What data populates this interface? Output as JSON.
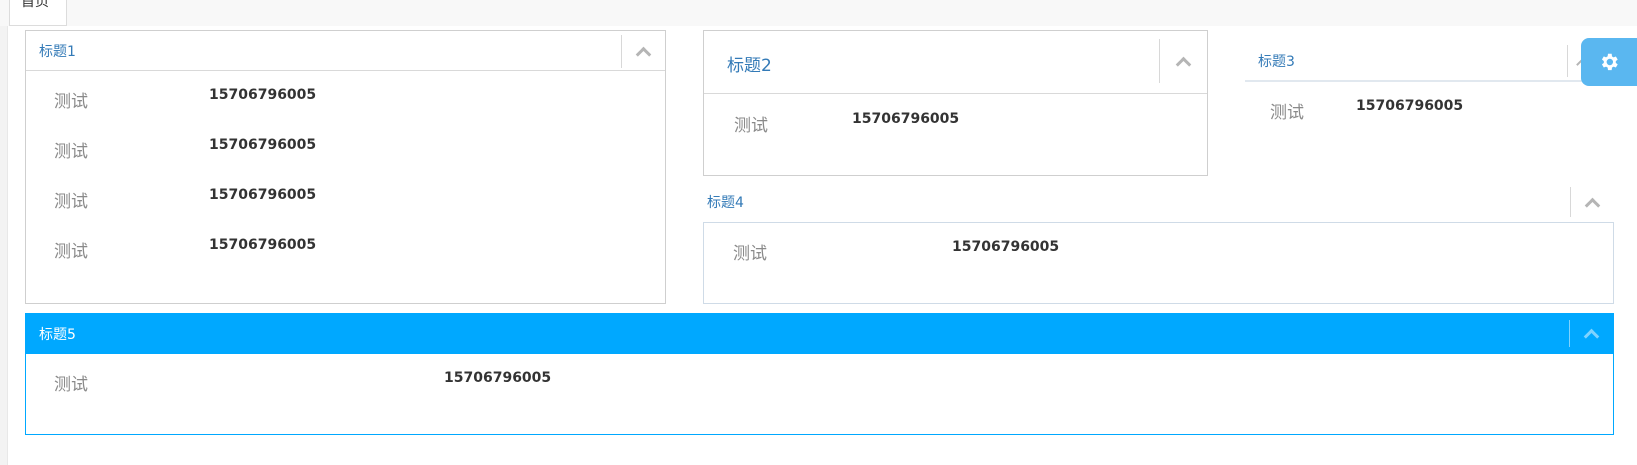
{
  "tabs": [
    {
      "label": "首页"
    }
  ],
  "panels": {
    "p1": {
      "title": "标题1",
      "rows": [
        {
          "label": "测试",
          "value": "15706796005"
        },
        {
          "label": "测试",
          "value": "15706796005"
        },
        {
          "label": "测试",
          "value": "15706796005"
        },
        {
          "label": "测试",
          "value": "15706796005"
        }
      ]
    },
    "p2": {
      "title": "标题2",
      "rows": [
        {
          "label": "测试",
          "value": "15706796005"
        }
      ]
    },
    "p3": {
      "title": "标题3",
      "rows": [
        {
          "label": "测试",
          "value": "15706796005"
        }
      ]
    },
    "p4": {
      "title": "标题4",
      "rows": [
        {
          "label": "测试",
          "value": "15706796005"
        }
      ]
    },
    "p5": {
      "title": "标题5",
      "rows": [
        {
          "label": "测试",
          "value": "15706796005"
        }
      ]
    }
  },
  "icons": {
    "collapse": "chevron-up-icon",
    "settings": "gear-icon"
  },
  "colors": {
    "title_blue": "#337ab7",
    "active_header": "#00a8ff",
    "settings_bg": "#5ab7f0"
  }
}
